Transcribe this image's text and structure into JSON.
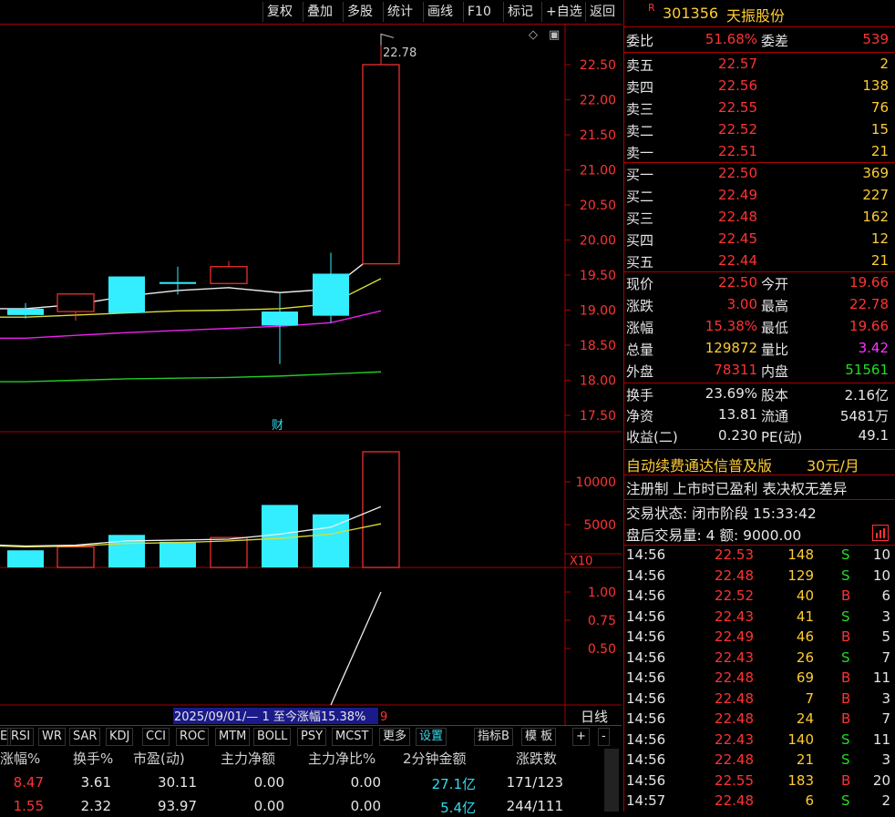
{
  "toolbar": {
    "items": [
      "复权",
      "叠加",
      "多股",
      "统计",
      "画线",
      "F10",
      "标记",
      "+自选",
      "返回"
    ]
  },
  "chart": {
    "price_ticks": [
      "22.50",
      "22.00",
      "21.50",
      "21.00",
      "20.50",
      "20.00",
      "19.50",
      "19.00",
      "18.50",
      "18.00",
      "17.50"
    ],
    "high_label": "22.78",
    "fin_marker": "财",
    "volume_ticks": [
      "10000",
      "5000"
    ],
    "volume_unit": "X10",
    "ind_ticks": [
      "1.00",
      "0.75",
      "0.50"
    ],
    "range_label": "2025/09/01/— 1 至今涨幅15.38%",
    "range_suffix": "9",
    "period": "日线"
  },
  "indicators": {
    "items": [
      "E",
      "RSI",
      "WR",
      "SAR",
      "KDJ",
      "CCI",
      "ROC",
      "MTM",
      "BOLL",
      "PSY",
      "MCST",
      "更多",
      "设置"
    ],
    "right": [
      "指标B",
      "模 板",
      "+",
      "-"
    ]
  },
  "table": {
    "headers": [
      "涨幅%",
      "换手%",
      "市盈(动)",
      "主力净额",
      "主力净比%",
      "2分钟金额",
      "涨跌数"
    ],
    "rows": [
      [
        "8.47",
        "3.61",
        "30.11",
        "0.00",
        "0.00",
        "27.1亿",
        "171/123"
      ],
      [
        "1.55",
        "2.32",
        "93.97",
        "0.00",
        "0.00",
        "5.4亿",
        "244/111"
      ]
    ]
  },
  "quote": {
    "badge": "R",
    "code": "301356",
    "name": "天振股份",
    "weibi_label": "委比",
    "weibi": "51.68%",
    "weicha_label": "委差",
    "weicha": "539",
    "asks": [
      {
        "label": "卖五",
        "price": "22.57",
        "vol": "2"
      },
      {
        "label": "卖四",
        "price": "22.56",
        "vol": "138"
      },
      {
        "label": "卖三",
        "price": "22.55",
        "vol": "76"
      },
      {
        "label": "卖二",
        "price": "22.52",
        "vol": "15"
      },
      {
        "label": "卖一",
        "price": "22.51",
        "vol": "21"
      }
    ],
    "bids": [
      {
        "label": "买一",
        "price": "22.50",
        "vol": "369"
      },
      {
        "label": "买二",
        "price": "22.49",
        "vol": "227"
      },
      {
        "label": "买三",
        "price": "22.48",
        "vol": "162"
      },
      {
        "label": "买四",
        "price": "22.45",
        "vol": "12"
      },
      {
        "label": "买五",
        "price": "22.44",
        "vol": "21"
      }
    ],
    "stats": [
      {
        "l1": "现价",
        "v1": "22.50",
        "l2": "今开",
        "v2": "19.66"
      },
      {
        "l1": "涨跌",
        "v1": "3.00",
        "l2": "最高",
        "v2": "22.78"
      },
      {
        "l1": "涨幅",
        "v1": "15.38%",
        "l2": "最低",
        "v2": "19.66"
      },
      {
        "l1": "总量",
        "v1": "129872",
        "l2": "量比",
        "v2": "3.42"
      },
      {
        "l1": "外盘",
        "v1": "78311",
        "l2": "内盘",
        "v2": "51561"
      }
    ],
    "stats2": [
      {
        "l1": "换手",
        "v1": "23.69%",
        "l2": "股本",
        "v2": "2.16亿"
      },
      {
        "l1": "净资",
        "v1": "13.81",
        "l2": "流通",
        "v2": "5481万"
      },
      {
        "l1": "收益(二)",
        "v1": "0.230",
        "l2": "PE(动)",
        "v2": "49.1"
      }
    ],
    "promo": "自动续费通达信普及版",
    "promo_price": "30元/月",
    "reg_note": "注册制 上市时已盈利 表决权无差异",
    "trade_status": "交易状态: 闭市阶段 15:33:42",
    "after_hours": "盘后交易量: 4  额: 9000.00",
    "ticks": [
      {
        "t": "14:56",
        "p": "22.53",
        "v": "148",
        "bs": "S",
        "n": "10"
      },
      {
        "t": "14:56",
        "p": "22.48",
        "v": "129",
        "bs": "S",
        "n": "10"
      },
      {
        "t": "14:56",
        "p": "22.52",
        "v": "40",
        "bs": "B",
        "n": "6"
      },
      {
        "t": "14:56",
        "p": "22.43",
        "v": "41",
        "bs": "S",
        "n": "3"
      },
      {
        "t": "14:56",
        "p": "22.49",
        "v": "46",
        "bs": "B",
        "n": "5"
      },
      {
        "t": "14:56",
        "p": "22.43",
        "v": "26",
        "bs": "S",
        "n": "7"
      },
      {
        "t": "14:56",
        "p": "22.48",
        "v": "69",
        "bs": "B",
        "n": "11"
      },
      {
        "t": "14:56",
        "p": "22.48",
        "v": "7",
        "bs": "B",
        "n": "3"
      },
      {
        "t": "14:56",
        "p": "22.48",
        "v": "24",
        "bs": "B",
        "n": "7"
      },
      {
        "t": "14:56",
        "p": "22.43",
        "v": "140",
        "bs": "S",
        "n": "11"
      },
      {
        "t": "14:56",
        "p": "22.48",
        "v": "21",
        "bs": "S",
        "n": "3"
      },
      {
        "t": "14:56",
        "p": "22.55",
        "v": "183",
        "bs": "B",
        "n": "20"
      },
      {
        "t": "14:57",
        "p": "22.48",
        "v": "6",
        "bs": "S",
        "n": "2"
      }
    ]
  },
  "chart_data": {
    "type": "candlestick",
    "candles": [
      {
        "o": 19.02,
        "c": 18.93,
        "h": 19.1,
        "l": 18.88
      },
      {
        "o": 18.98,
        "c": 19.23,
        "h": 19.23,
        "l": 18.85
      },
      {
        "o": 19.48,
        "c": 18.96,
        "h": 19.48,
        "l": 18.96
      },
      {
        "o": 19.4,
        "c": 19.38,
        "h": 19.62,
        "l": 19.22
      },
      {
        "o": 19.38,
        "c": 19.62,
        "h": 19.7,
        "l": 19.38
      },
      {
        "o": 18.98,
        "c": 18.78,
        "h": 19.25,
        "l": 18.23
      },
      {
        "o": 19.52,
        "c": 18.92,
        "h": 19.82,
        "l": 18.82
      },
      {
        "o": 19.66,
        "c": 22.5,
        "h": 22.78,
        "l": 19.66
      }
    ],
    "ma_white": [
      19.02,
      19.08,
      19.2,
      19.28,
      19.32,
      19.25,
      19.3,
      19.86
    ],
    "ma_yellow": [
      18.9,
      18.93,
      18.96,
      18.99,
      19.0,
      19.02,
      19.09,
      19.45
    ],
    "ma_magenta": [
      18.6,
      18.64,
      18.68,
      18.71,
      18.74,
      18.77,
      18.82,
      18.99
    ],
    "ma_green": [
      17.98,
      18.0,
      18.02,
      18.03,
      18.04,
      18.06,
      18.09,
      18.12
    ],
    "volume": [
      2000,
      2400,
      3800,
      3000,
      3500,
      7300,
      6200,
      16000
    ],
    "vol_ma_white": [
      2500,
      2600,
      3100,
      3200,
      3300,
      3900,
      4700,
      7100
    ],
    "vol_ma_yellow": [
      2400,
      2500,
      2800,
      2900,
      3100,
      3400,
      3900,
      5100
    ],
    "indicator": [
      0.0,
      0.0,
      0.0,
      0.0,
      0.0,
      0.0,
      0.0,
      1.0
    ],
    "colors": {
      "up": "#ff3333",
      "down": "#33eeff"
    }
  }
}
